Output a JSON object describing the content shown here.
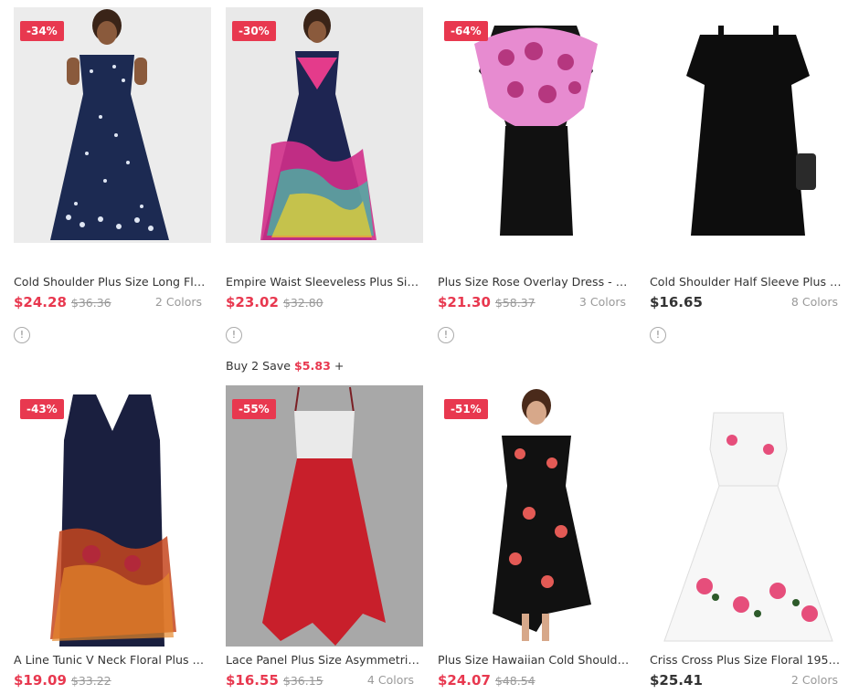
{
  "colors": {
    "accent": "#e8384f",
    "muted": "#999999",
    "text": "#333333"
  },
  "info_icon_glyph": "!",
  "products": [
    {
      "badge": "-34%",
      "title": "Cold Shoulder Plus Size Long Flo...",
      "price": "$24.28",
      "orig": "$36.36",
      "colors": "2 Colors",
      "info": true,
      "image": "navy floral maxi dress"
    },
    {
      "badge": "-30%",
      "title": "Empire Waist Sleeveless Plus Siz...",
      "price": "$23.02",
      "orig": "$32.80",
      "colors": "",
      "info": true,
      "promo_prefix": "Buy 2 Save",
      "promo_amount": "$5.83",
      "promo_suffix": "+",
      "image": "colorful splatter maxi dress"
    },
    {
      "badge": "-64%",
      "title": "Plus Size Rose Overlay Dress - Pl...",
      "price": "$21.30",
      "orig": "$58.37",
      "colors": "3 Colors",
      "info": true,
      "image": "pink rose overlay black dress"
    },
    {
      "badge": "",
      "title": "Cold Shoulder Half Sleeve Plus Si...",
      "price": "$16.65",
      "orig": "",
      "colors": "8 Colors",
      "info": true,
      "image": "black cold shoulder dress"
    },
    {
      "badge": "-43%",
      "title": "A Line Tunic V Neck Floral Plus Si...",
      "price": "$19.09",
      "orig": "$33.22",
      "colors": "",
      "info": false,
      "image": "navy floral handkerchief dress"
    },
    {
      "badge": "-55%",
      "title": "Lace Panel Plus Size Asymmetric...",
      "price": "$16.55",
      "orig": "$36.15",
      "colors": "4 Colors",
      "info": false,
      "image": "red lace panel dress"
    },
    {
      "badge": "-51%",
      "title": "Plus Size Hawaiian Cold Shoulder...",
      "price": "$24.07",
      "orig": "$48.54",
      "colors": "",
      "info": false,
      "image": "black floral hawaiian dress"
    },
    {
      "badge": "",
      "title": "Criss Cross Plus Size Floral 1950s...",
      "price": "$25.41",
      "orig": "",
      "colors": "2 Colors",
      "info": false,
      "image": "white floral 1950s dress"
    }
  ]
}
